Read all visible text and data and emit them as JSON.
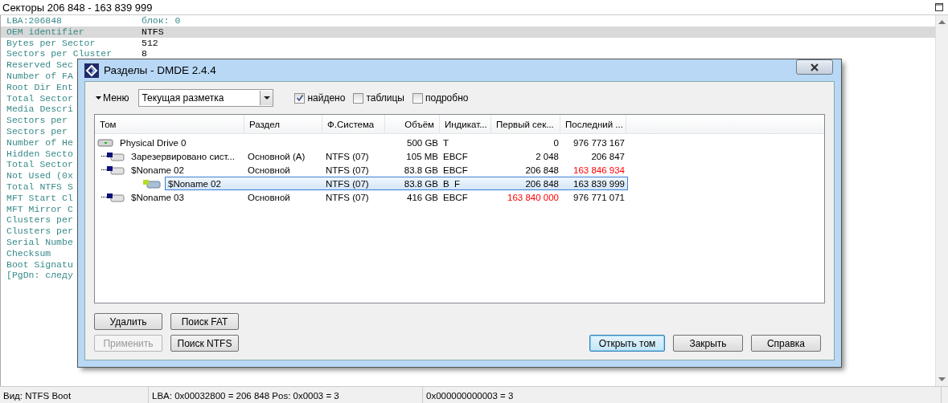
{
  "sector_view": {
    "title": "Секторы 206 848 - 163 839 999",
    "rows": [
      {
        "kind": "header",
        "label": "LBA:206848",
        "value": "блок: 0",
        "selected": false
      },
      {
        "kind": "field",
        "label": "OEM identifier",
        "value": "NTFS",
        "selected": true
      },
      {
        "kind": "field",
        "label": "Bytes per Sector",
        "value": "512",
        "selected": false
      },
      {
        "kind": "field",
        "label": "Sectors per Cluster",
        "value": "8",
        "selected": false
      },
      {
        "kind": "field",
        "label": "Reserved Sec",
        "selected": false
      },
      {
        "kind": "field",
        "label": "Number of FA",
        "selected": false
      },
      {
        "kind": "field",
        "label": "Root Dir Ent",
        "selected": false
      },
      {
        "kind": "field",
        "label": "Total Sector",
        "selected": false
      },
      {
        "kind": "field",
        "label": "Media Descri",
        "selected": false
      },
      {
        "kind": "field",
        "label": "Sectors per",
        "selected": false
      },
      {
        "kind": "field",
        "label": "Sectors per",
        "selected": false
      },
      {
        "kind": "field",
        "label": "Number of He",
        "selected": false
      },
      {
        "kind": "field",
        "label": "Hidden Secto",
        "selected": false
      },
      {
        "kind": "field",
        "label": "Total Sector",
        "selected": false
      },
      {
        "kind": "field",
        "label": "Not Used (0x",
        "selected": false
      },
      {
        "kind": "field",
        "label": "Total NTFS S",
        "selected": false
      },
      {
        "kind": "field",
        "label": "MFT Start Cl",
        "selected": false
      },
      {
        "kind": "field",
        "label": "MFT Mirror C",
        "selected": false
      },
      {
        "kind": "field",
        "label": "Clusters per",
        "selected": false
      },
      {
        "kind": "field",
        "label": "Clusters per",
        "selected": false
      },
      {
        "kind": "field",
        "label": "Serial Numbe",
        "selected": false
      },
      {
        "kind": "field",
        "label": "Checksum",
        "selected": false
      },
      {
        "kind": "field",
        "label": "Boot Signatu",
        "selected": false
      },
      {
        "kind": "field",
        "label": "[PgDn: следу",
        "selected": false
      }
    ]
  },
  "status_bar": [
    "Вид: NTFS Boot",
    "LBA: 0x00032800 = 206 848  Pos: 0x0003 = 3",
    "0x000000000003 = 3"
  ],
  "dialog": {
    "title": "Разделы - DMDE 2.4.4",
    "menu_label": "Меню",
    "view_dropdown": {
      "value": "Текущая разметка"
    },
    "checkboxes": [
      {
        "label": "найдено",
        "checked": true
      },
      {
        "label": "таблицы",
        "checked": false
      },
      {
        "label": "подробно",
        "checked": false
      }
    ],
    "table": {
      "columns": [
        "Том",
        "Раздел",
        "Ф.Система",
        "Объём",
        "Индикат...",
        "Первый сек...",
        "Последний ..."
      ],
      "rows": [
        {
          "kind": "disk",
          "volume": "Physical Drive 0",
          "size": "500 GB",
          "flags": "T",
          "first_sector": "0",
          "last_sector": "976 773 167",
          "first_warning": false,
          "last_warning": false,
          "selected": false,
          "children": [
            {
              "kind": "partition",
              "volume": "Зарезервировано сист...",
              "partition": "Основной (A)",
              "fs": "NTFS (07)",
              "size": "105 MB",
              "flags": "EBCF",
              "first_sector": "2 048",
              "last_sector": "206 847",
              "first_warning": false,
              "last_warning": false,
              "selected": false
            },
            {
              "kind": "partition",
              "volume": "$Noname 02",
              "partition": "Основной",
              "fs": "NTFS (07)",
              "size": "83.8 GB",
              "flags": "EBCF",
              "first_sector": "206 848",
              "last_sector": "163 846 934",
              "first_warning": false,
              "last_warning": true,
              "selected": false,
              "children": [
                {
                  "kind": "found",
                  "volume": "$Noname 02",
                  "fs": "NTFS (07)",
                  "size": "83.8 GB",
                  "flags": "B  F",
                  "first_sector": "206 848",
                  "last_sector": "163 839 999",
                  "first_warning": false,
                  "last_warning": false,
                  "selected": true
                }
              ]
            },
            {
              "kind": "partition",
              "volume": "$Noname 03",
              "partition": "Основной",
              "fs": "NTFS (07)",
              "size": "416 GB",
              "flags": "EBCF",
              "first_sector": "163 840 000",
              "last_sector": "976 771 071",
              "first_warning": true,
              "last_warning": false,
              "selected": false
            }
          ]
        }
      ]
    },
    "left_buttons": [
      {
        "label": "Удалить",
        "disabled": false
      },
      {
        "label": "Поиск FAT",
        "disabled": false
      },
      {
        "label": "Применить",
        "disabled": true
      },
      {
        "label": "Поиск NTFS",
        "disabled": false
      }
    ],
    "right_buttons": [
      {
        "label": "Открыть том",
        "default": true
      },
      {
        "label": "Закрыть",
        "default": false
      },
      {
        "label": "Справка",
        "default": false
      }
    ]
  }
}
